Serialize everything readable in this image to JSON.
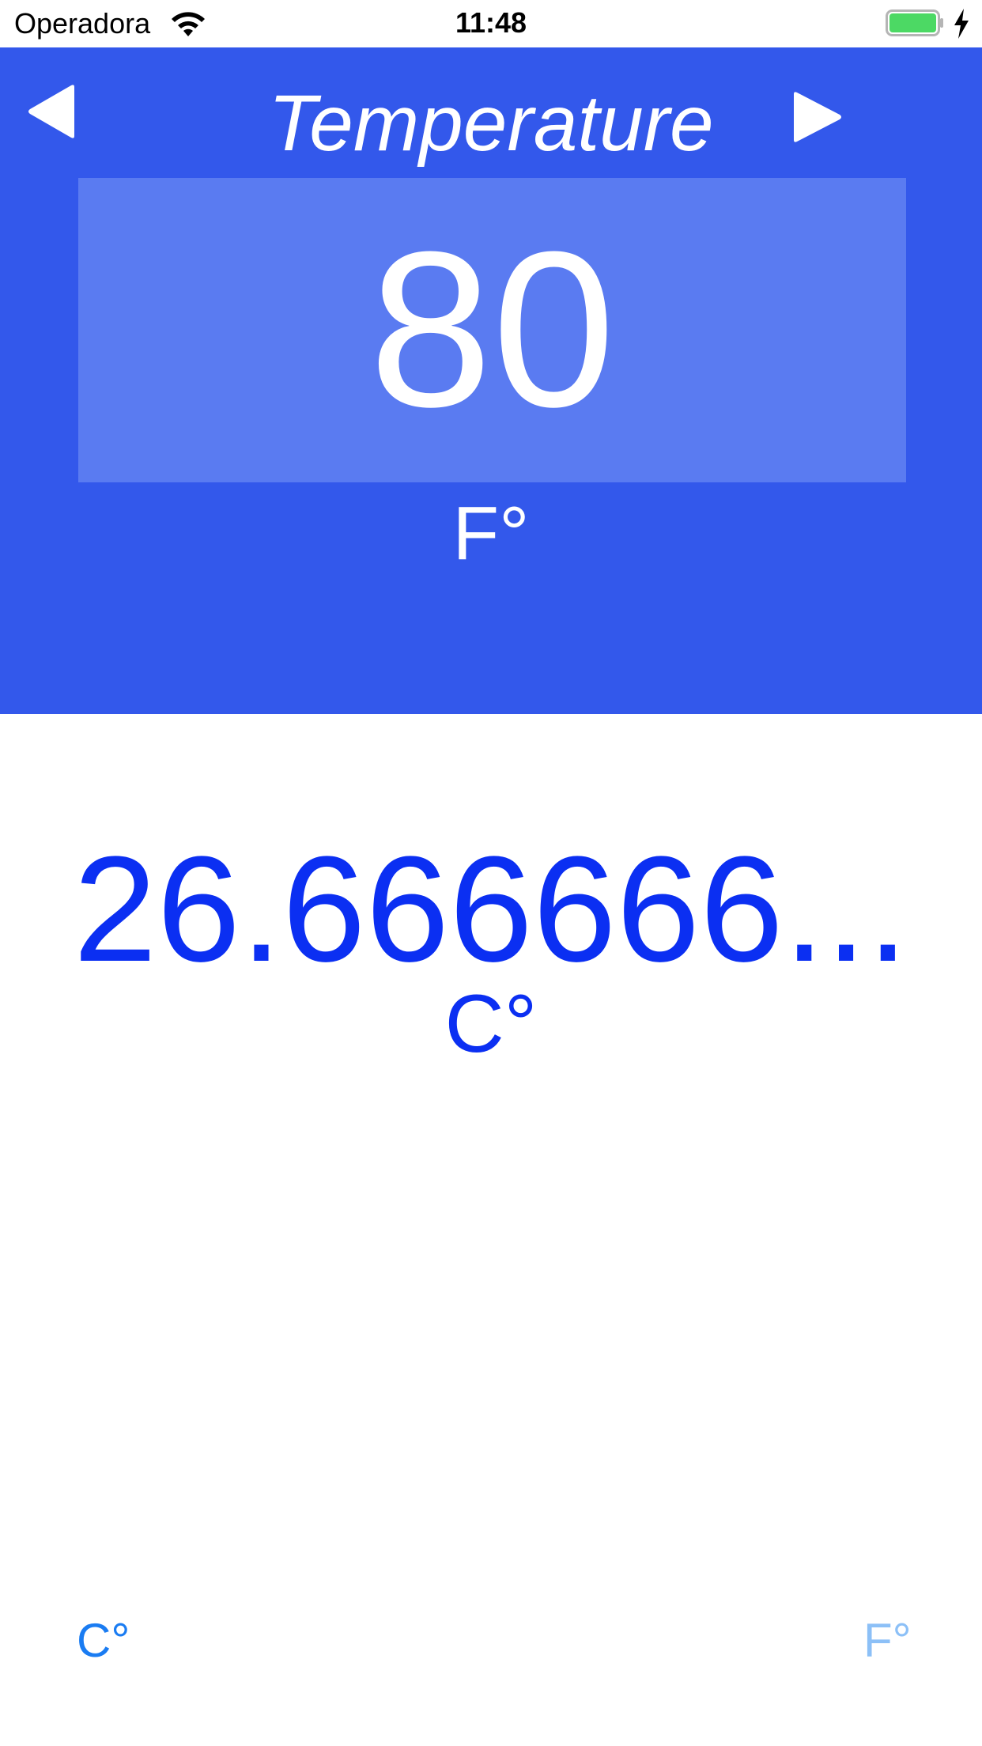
{
  "status_bar": {
    "carrier": "Operadora",
    "time": "11:48",
    "wifi_icon": "wifi-icon",
    "battery_icon": "battery-full-icon",
    "battery_color": "#4cd964",
    "charging_icon": "charging-bolt-icon"
  },
  "header": {
    "title": "Temperature",
    "prev_icon": "triangle-left-icon",
    "next_icon": "triangle-right-icon",
    "input_value": "80",
    "input_unit": "F°",
    "background_color": "#3358eb",
    "input_background_color": "#5a7bf1"
  },
  "result": {
    "value": "26.666666...",
    "unit": "C°",
    "color": "#0b2ff2"
  },
  "unit_buttons": {
    "celsius_label": "C°",
    "fahrenheit_label": "F°",
    "active_color": "#1a7cf2",
    "inactive_color": "#8cc0f7"
  }
}
